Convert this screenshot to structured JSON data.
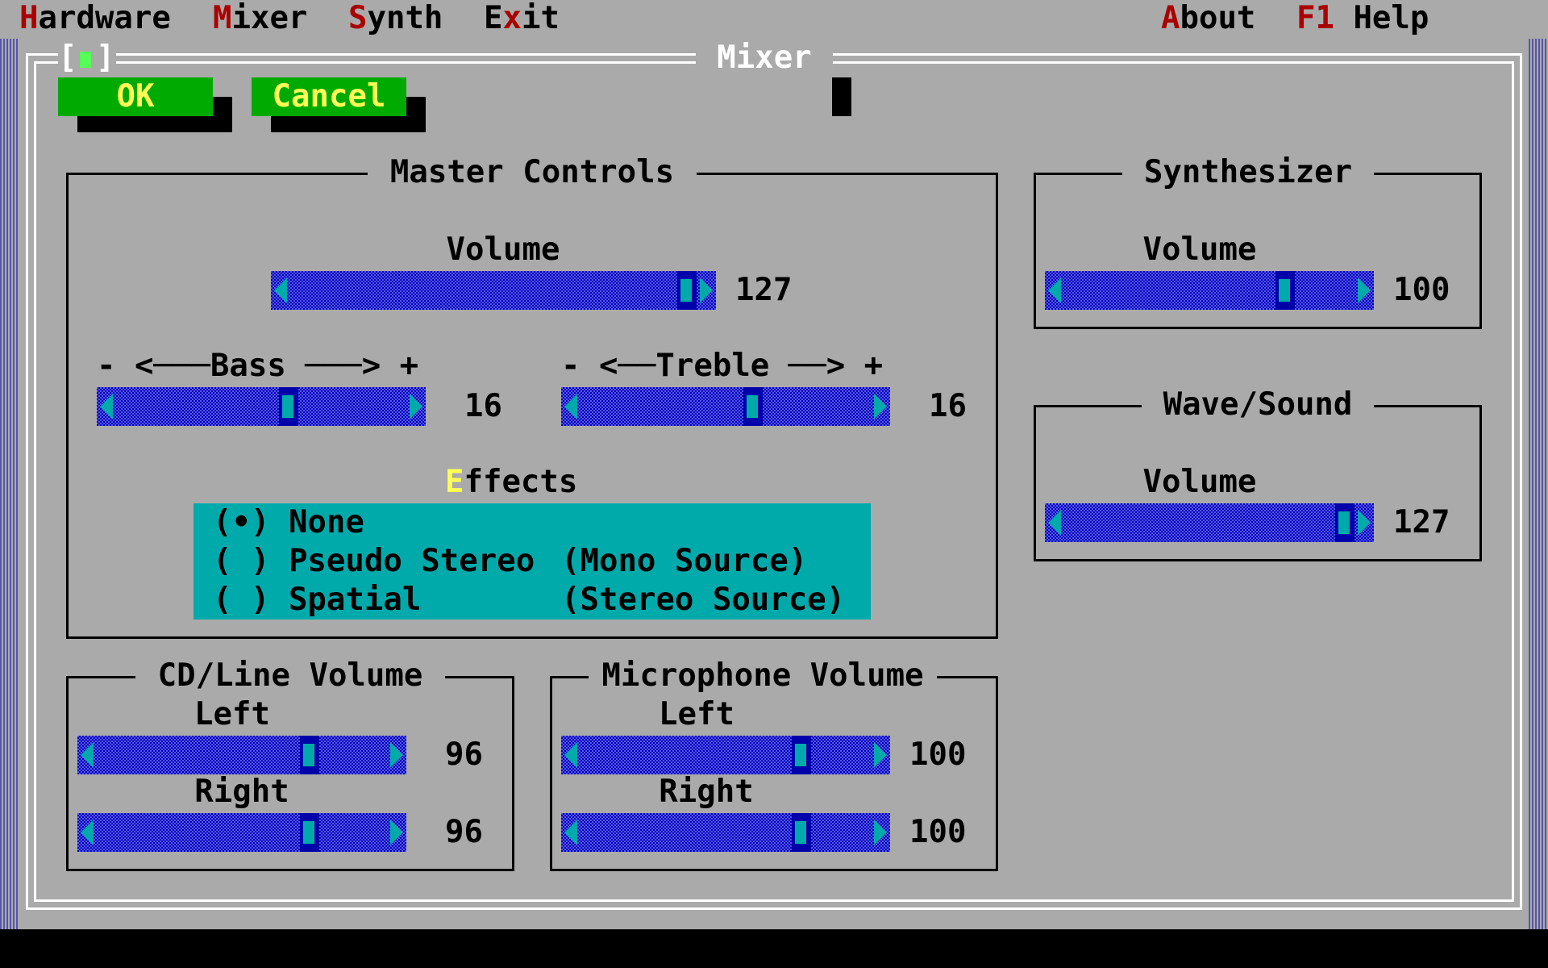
{
  "menubar": {
    "hardware": {
      "hot": "H",
      "rest": "ardware"
    },
    "mixer": {
      "hot": "M",
      "rest": "ixer"
    },
    "synth": {
      "hot": "S",
      "rest": "ynth"
    },
    "exit": {
      "pre": "E",
      "hot": "x",
      "rest": "it"
    },
    "about": {
      "hot": "A",
      "rest": "bout"
    },
    "help": {
      "hot": "F1",
      "rest": " Help"
    }
  },
  "dialog": {
    "title": "Mixer",
    "close_left": "[",
    "close_right": "]"
  },
  "buttons": {
    "ok": "OK",
    "cancel_hot": "C",
    "cancel_rest": "ancel"
  },
  "master": {
    "title": "Master Controls",
    "volume_label": "Volume",
    "volume": {
      "value": "127",
      "level": 1.0
    },
    "bass_label": "- <───Bass ───> +",
    "bass": {
      "value": "16",
      "level": 0.6
    },
    "treble_label": "- <──Treble ──> +",
    "treble": {
      "value": "16",
      "level": 0.6
    },
    "effects_hot": "E",
    "effects_rest": "ffects",
    "effects_options": [
      {
        "mark": "(•)",
        "label": "None",
        "note": ""
      },
      {
        "mark": "( )",
        "label": "Pseudo Stereo",
        "note": "(Mono Source)"
      },
      {
        "mark": "( )",
        "label": "Spatial",
        "note": "(Stereo Source)"
      }
    ]
  },
  "synth": {
    "title": "Synthesizer",
    "volume_label": "Volume",
    "volume": {
      "value": "100",
      "level": 0.78
    }
  },
  "wave": {
    "title": "Wave/Sound",
    "volume_label": "Volume",
    "volume": {
      "value": "127",
      "level": 1.0
    }
  },
  "cdline": {
    "title": "CD/Line Volume",
    "left_label": "Left",
    "left": {
      "value": "96",
      "level": 0.75
    },
    "right_label": "Right",
    "right": {
      "value": "96",
      "level": 0.75
    }
  },
  "mic": {
    "title": "Microphone Volume",
    "left_label": "Left",
    "left": {
      "value": "100",
      "level": 0.78
    },
    "right_label": "Right",
    "right": {
      "value": "100",
      "level": 0.78
    }
  },
  "colors": {
    "background": "#aaaaaa",
    "button": "#00aa00",
    "slider": "#0000aa",
    "accent": "#00aaaa",
    "hotkey_menu": "#aa0000",
    "hotkey_dialog": "#ffff55"
  }
}
